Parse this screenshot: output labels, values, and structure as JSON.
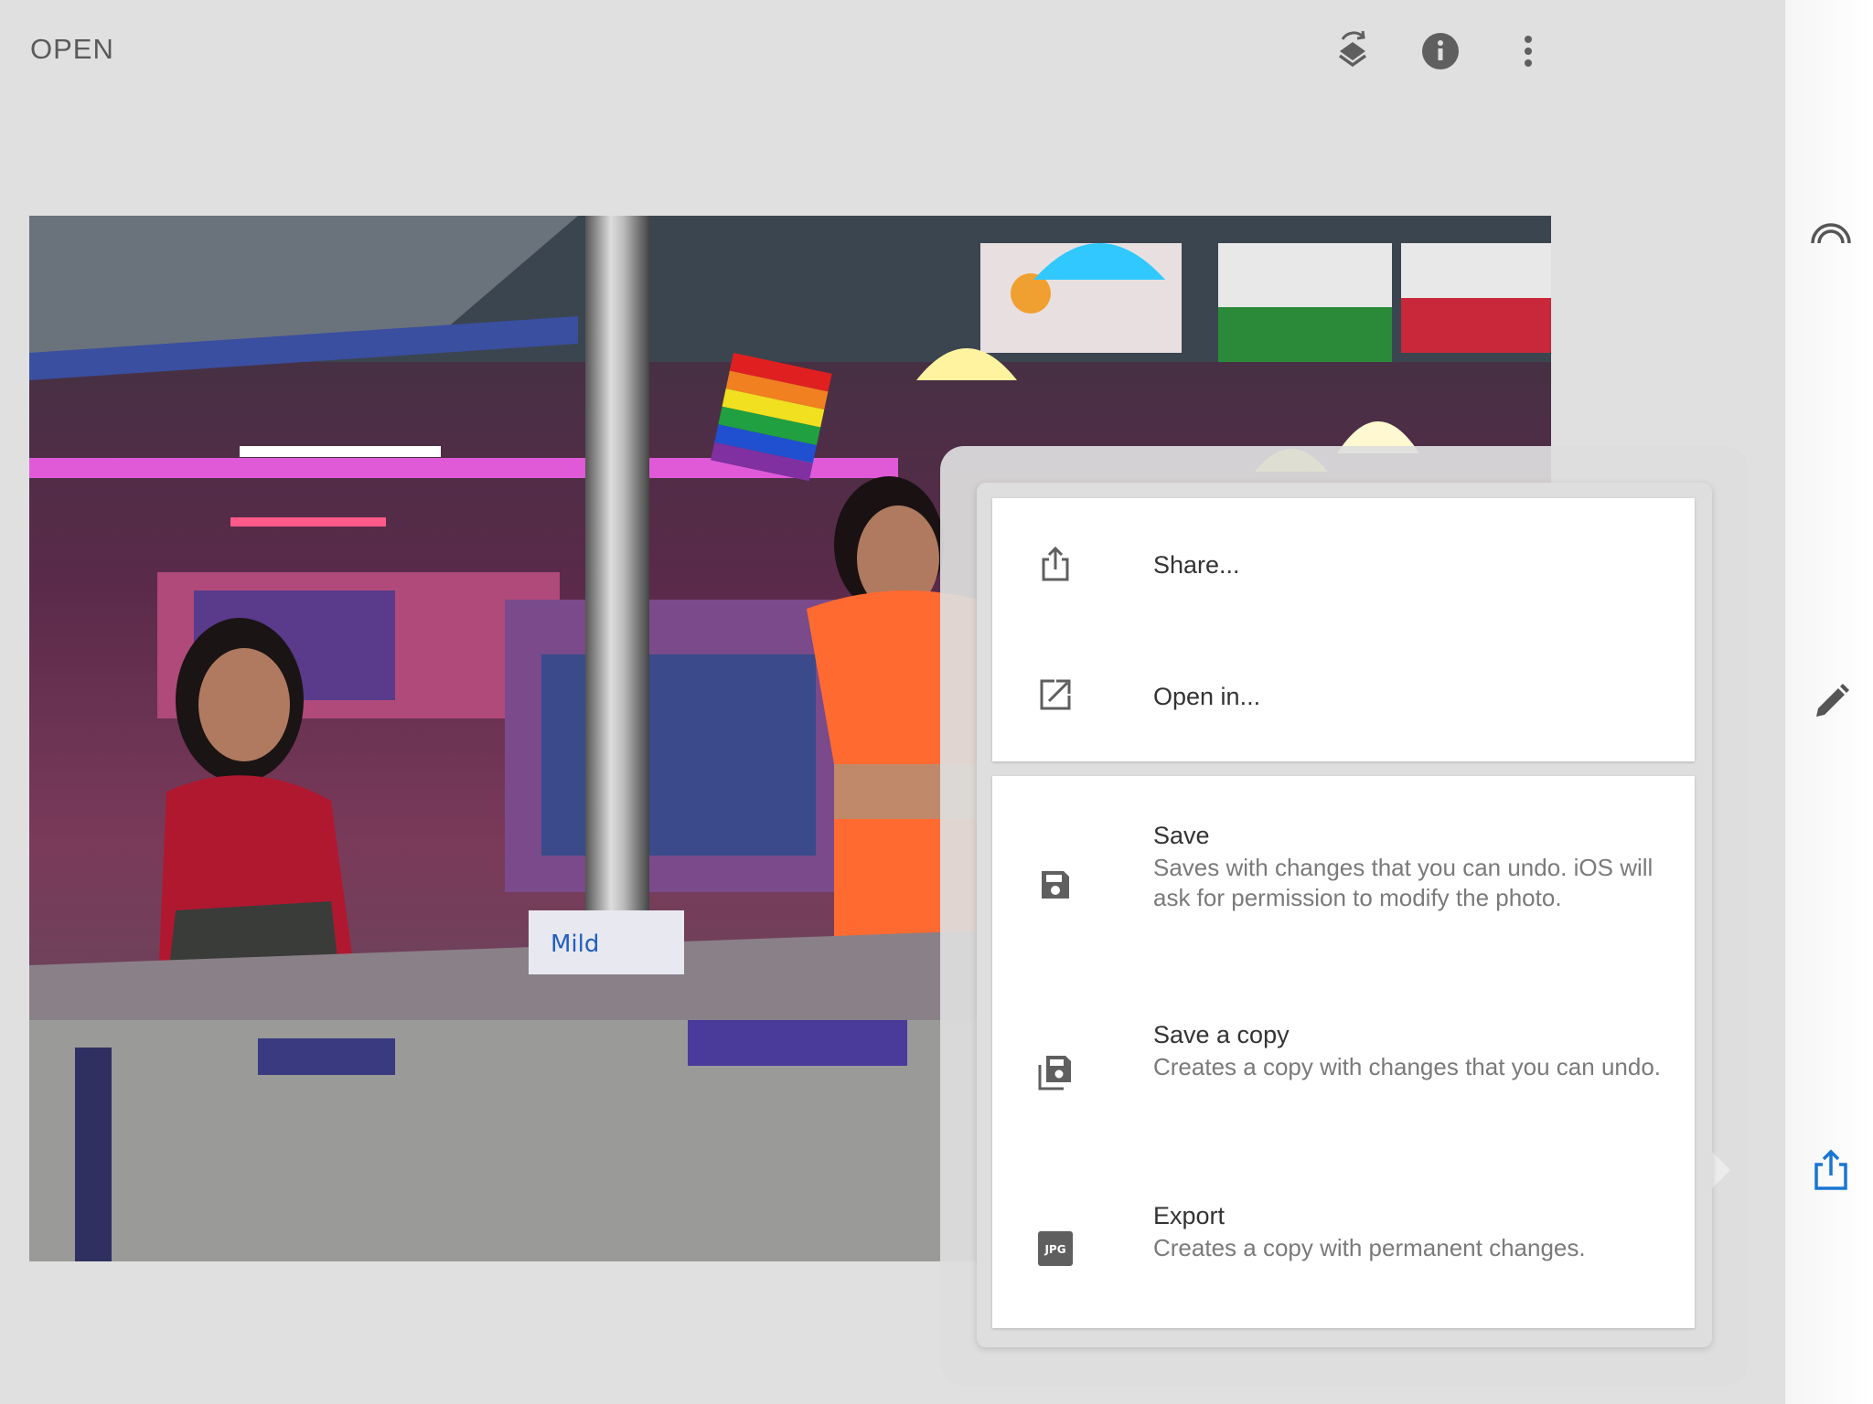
{
  "toolbar": {
    "open_label": "OPEN",
    "icons": [
      "layers-undo-icon",
      "info-icon",
      "more-vert-icon"
    ]
  },
  "right_rail": {
    "icons": [
      "looks-icon",
      "edit-pencil-icon",
      "export-share-icon"
    ],
    "accent_color": "#1976d2"
  },
  "export_menu": {
    "items": [
      {
        "icon": "share-icon",
        "title": "Share...",
        "description": ""
      },
      {
        "icon": "open-in-icon",
        "title": "Open in...",
        "description": ""
      },
      {
        "icon": "save-icon",
        "title": "Save",
        "description": "Saves with changes that you can undo. iOS will ask for permission to modify the photo."
      },
      {
        "icon": "save-copy-icon",
        "title": "Save a copy",
        "description": "Creates a copy with changes that you can undo."
      },
      {
        "icon": "jpg-export-icon",
        "title": "Export",
        "description": "Creates a copy with permanent changes.",
        "badge": "JPG"
      }
    ]
  },
  "photo": {
    "sign_text": "Mild"
  }
}
